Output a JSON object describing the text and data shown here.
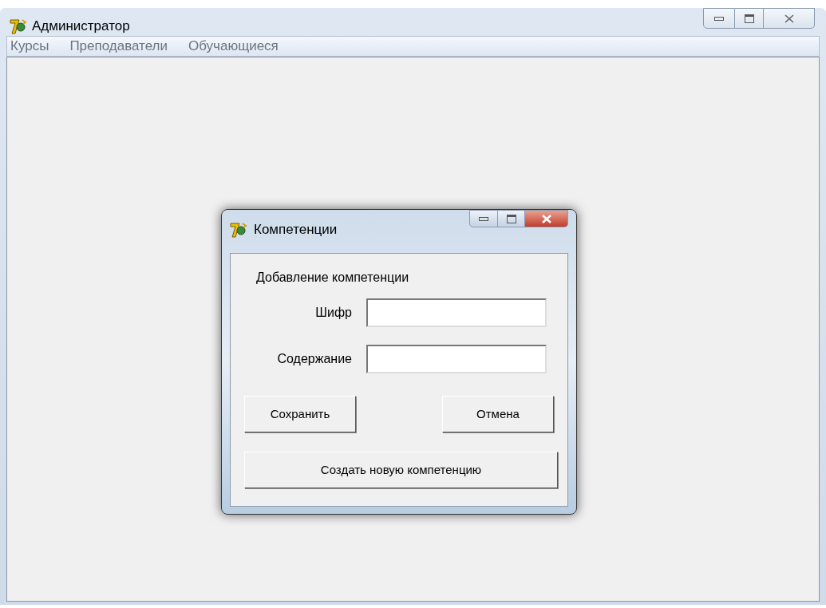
{
  "window": {
    "title": "Администратор"
  },
  "menu": [
    {
      "label": "Курсы"
    },
    {
      "label": "Преподаватели"
    },
    {
      "label": "Обучающиеся"
    }
  ],
  "dialog": {
    "title": "Компетенции",
    "heading": "Добавление компетенции",
    "fields": [
      {
        "label": "Шифр"
      },
      {
        "label": "Содержание"
      }
    ],
    "buttons": [
      {
        "label": "Сохранить"
      },
      {
        "label": "Отмена"
      }
    ],
    "wide_button": {
      "label": "Создать новую компетенцию"
    }
  }
}
